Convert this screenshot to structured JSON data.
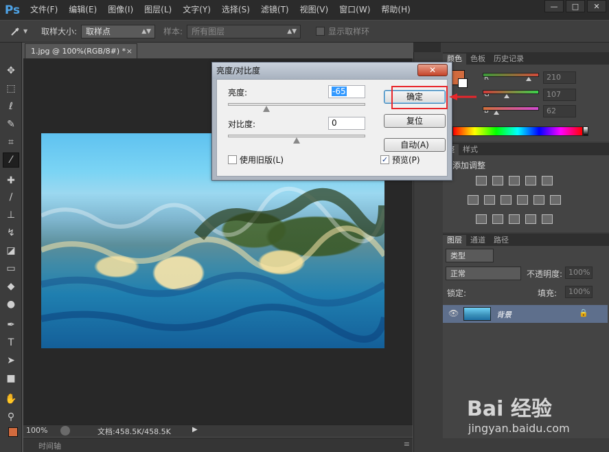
{
  "app": {
    "logo": "Ps"
  },
  "menu": [
    "文件(F)",
    "编辑(E)",
    "图像(I)",
    "图层(L)",
    "文字(Y)",
    "选择(S)",
    "滤镜(T)",
    "视图(V)",
    "窗口(W)",
    "帮助(H)"
  ],
  "window_controls": [
    "—",
    "□",
    "✕"
  ],
  "options": {
    "sample_size_label": "取样大小:",
    "sample_size_value": "取样点",
    "sample_label": "样本:",
    "sample_value": "所有图层",
    "show_ring_label": "显示取样环"
  },
  "document": {
    "tab_title": "1.jpg @ 100%(RGB/8#) *",
    "tab_close": "×",
    "zoom": "100%",
    "doc_info": "文档:458.5K/458.5K",
    "timeline_label": "时间轴"
  },
  "color_panel": {
    "tabs": [
      "颜色",
      "色板",
      "历史记录"
    ],
    "channels": [
      {
        "label": "R",
        "value": "210",
        "grad_start": "#3a9a3a",
        "grad_end": "#d24a3a",
        "level": 0.82
      },
      {
        "label": "G",
        "value": "107",
        "grad_start": "#d23a3a",
        "grad_end": "#3ad24a",
        "level": 0.42
      },
      {
        "label": "B",
        "value": "62",
        "grad_start": "#d2703a",
        "grad_end": "#d24ad2",
        "level": 0.24
      }
    ],
    "foreground_color": "#d26b3e"
  },
  "adjust_panel": {
    "tabs": [
      "整",
      "样式"
    ],
    "title": "添加调整"
  },
  "layers_panel": {
    "tabs": [
      "图层",
      "通道",
      "路径"
    ],
    "filter_label": "类型",
    "blend_mode": "正常",
    "opacity_label": "不透明度:",
    "opacity_value": "100%",
    "lock_label": "锁定:",
    "fill_label": "填充:",
    "fill_value": "100%",
    "layer_name": "背景"
  },
  "dialog": {
    "title": "亮度/对比度",
    "close": "✕",
    "brightness_label": "亮度:",
    "brightness_value": "-65",
    "brightness_level": 0.28,
    "contrast_label": "对比度:",
    "contrast_value": "0",
    "contrast_level": 0.5,
    "ok_label": "确定",
    "reset_label": "复位",
    "auto_label": "自动(A)",
    "legacy_label": "使用旧版(L)",
    "legacy_checked": false,
    "preview_label": "预览(P)",
    "preview_checked": true
  },
  "watermark": {
    "brand": "Bai 经验",
    "url": "jingyan.baidu.com"
  }
}
